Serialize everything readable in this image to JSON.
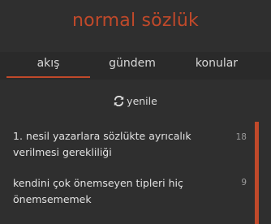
{
  "brand": {
    "title": "normal sözlük"
  },
  "tabs": [
    {
      "label": "akış",
      "active": true
    },
    {
      "label": "gündem",
      "active": false
    },
    {
      "label": "konular",
      "active": false
    }
  ],
  "refresh": {
    "label": "yenile",
    "icon": "refresh-icon"
  },
  "entries": [
    {
      "title": "1. nesil yazarlara sözlükte ayrıcalık verilmesi gerekliliği",
      "count": "18"
    },
    {
      "title": "kendini çok önemseyen tipleri hiç önemsememek",
      "count": "9"
    }
  ],
  "colors": {
    "accent": "#c0492a",
    "background": "#2f2f2f",
    "nav_background": "#2a2a2a"
  }
}
